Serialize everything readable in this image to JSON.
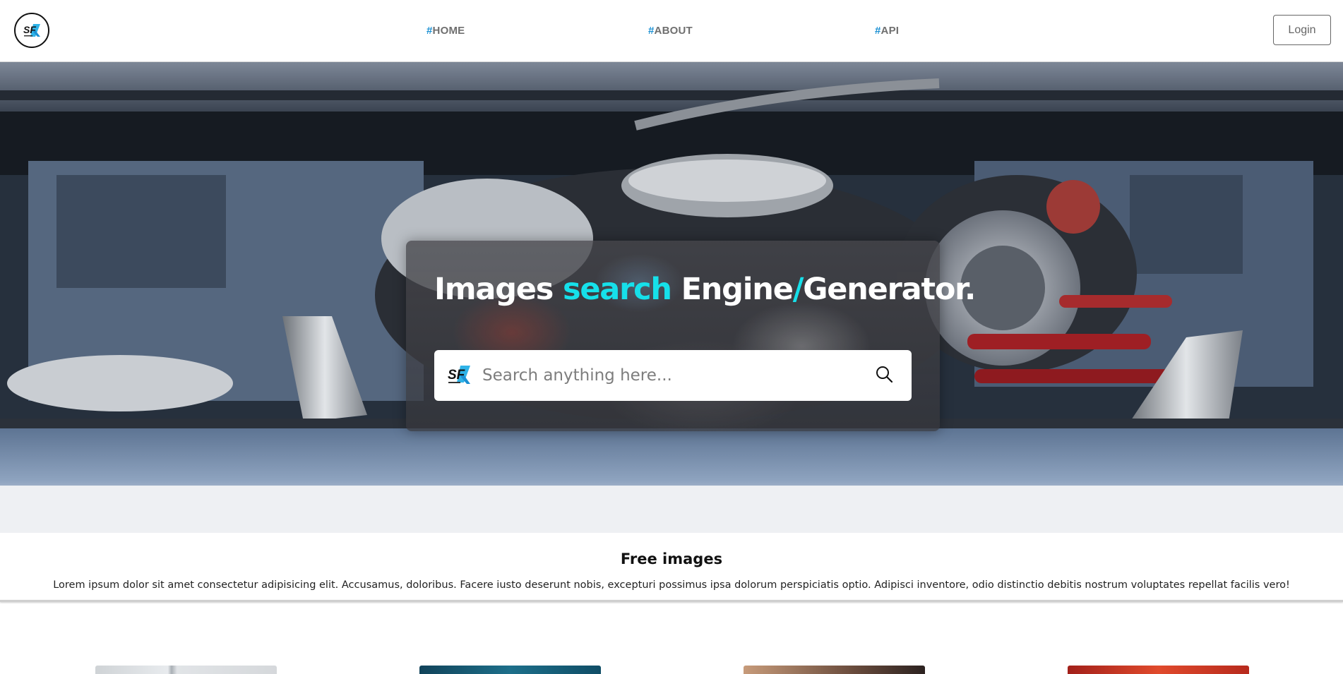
{
  "navbar": {
    "logo_text": "SF",
    "links": [
      {
        "hash": "#",
        "label": "HOME"
      },
      {
        "hash": "#",
        "label": "ABOUT"
      },
      {
        "hash": "#",
        "label": "API"
      }
    ],
    "login_label": "Login"
  },
  "hero": {
    "headline": {
      "part1": "Images ",
      "part2": "search",
      "part3": " Engine",
      "part4": "/",
      "part5": "Generator."
    },
    "search": {
      "placeholder": "Search anything here...",
      "value": "",
      "icon": "search-icon"
    }
  },
  "free_images": {
    "title": "Free images",
    "text": "Lorem ipsum dolor sit amet consectetur adipisicing elit. Accusamus, doloribus. Facere iusto deserunt nobis, excepturi possimus ipsa dolorum perspiciatis optio. Adipisci inventore, odio distinctio debitis nostrum voluptates repellat facilis vero!"
  },
  "colors": {
    "accent": "#16e0ea",
    "nav_hash": "#1b90d3",
    "nav_text": "#6f6f6f"
  }
}
